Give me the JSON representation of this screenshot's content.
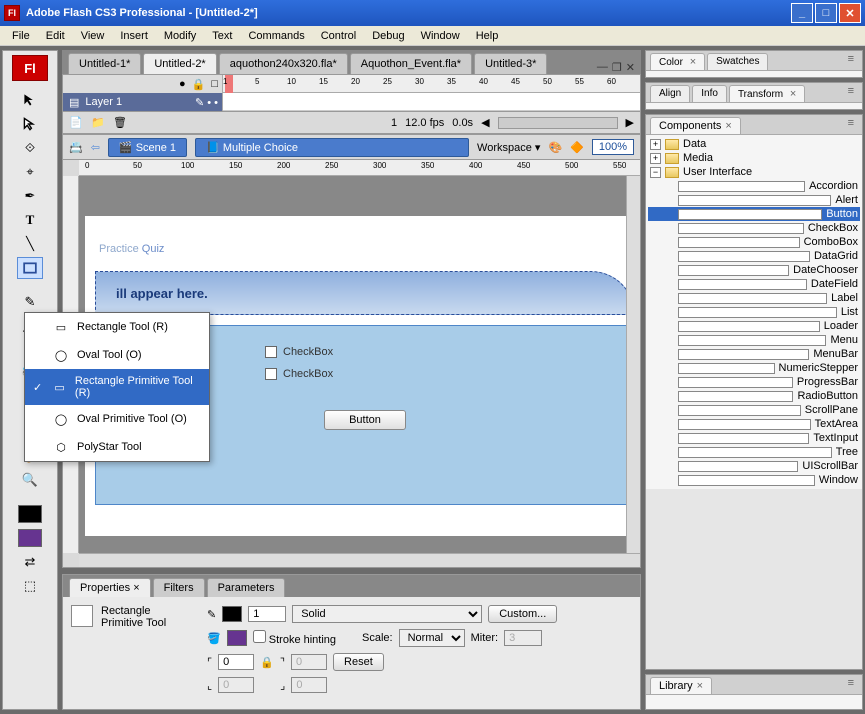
{
  "window": {
    "title": "Adobe Flash CS3 Professional - [Untitled-2*]",
    "logo": "Fl"
  },
  "menu": [
    "File",
    "Edit",
    "View",
    "Insert",
    "Modify",
    "Text",
    "Commands",
    "Control",
    "Debug",
    "Window",
    "Help"
  ],
  "docTabs": [
    "Untitled-1*",
    "Untitled-2*",
    "aquothon240x320.fla*",
    "Aquothon_Event.fla*",
    "Untitled-3*"
  ],
  "activeDocTab": 1,
  "timeline": {
    "layer": "Layer 1",
    "frameMarks": [
      1,
      5,
      10,
      15,
      20,
      25,
      30,
      35,
      40,
      45,
      50,
      55,
      60
    ],
    "status": {
      "frame": "1",
      "fps": "12.0 fps",
      "time": "0.0s"
    }
  },
  "editbar": {
    "scene": "Scene 1",
    "crumb": "Multiple Choice",
    "workspace": "Workspace ▾",
    "zoom": "100%"
  },
  "rulerMarks": [
    "0",
    "50",
    "100",
    "150",
    "200",
    "250",
    "300",
    "350",
    "400",
    "450",
    "500",
    "550"
  ],
  "quiz": {
    "title1": "Practice ",
    "title2": "Quiz",
    "header": "ill appear here.",
    "checkbox": "CheckBox",
    "button": "Button"
  },
  "flyout": [
    {
      "label": "Rectangle Tool (R)",
      "sel": false,
      "icon": "rect"
    },
    {
      "label": "Oval Tool (O)",
      "sel": false,
      "icon": "oval"
    },
    {
      "label": "Rectangle Primitive Tool (R)",
      "sel": true,
      "icon": "rectp"
    },
    {
      "label": "Oval Primitive Tool (O)",
      "sel": false,
      "icon": "ovalp"
    },
    {
      "label": "PolyStar Tool",
      "sel": false,
      "icon": "poly"
    }
  ],
  "props": {
    "tabs": [
      "Properties",
      "Filters",
      "Parameters"
    ],
    "toolName": "Rectangle Primitive Tool",
    "strokeWidth": "1",
    "strokeStyle": "Solid",
    "custom": "Custom...",
    "hinting": "Stroke hinting",
    "scaleLabel": "Scale:",
    "scale": "Normal",
    "miterLabel": "Miter:",
    "miter": "3",
    "corner": "0",
    "cornerGrey": "0",
    "reset": "Reset"
  },
  "panels": {
    "color": [
      "Color",
      "Swatches"
    ],
    "align": [
      "Align",
      "Info",
      "Transform"
    ],
    "compTab": "Components",
    "tree": {
      "top": [
        {
          "label": "Data",
          "open": false
        },
        {
          "label": "Media",
          "open": false
        },
        {
          "label": "User Interface",
          "open": true
        }
      ],
      "ui": [
        "Accordion",
        "Alert",
        "Button",
        "CheckBox",
        "ComboBox",
        "DataGrid",
        "DateChooser",
        "DateField",
        "Label",
        "List",
        "Loader",
        "Menu",
        "MenuBar",
        "NumericStepper",
        "ProgressBar",
        "RadioButton",
        "ScrollPane",
        "TextArea",
        "TextInput",
        "Tree",
        "UIScrollBar",
        "Window"
      ],
      "selected": "Button"
    },
    "libTab": "Library"
  }
}
